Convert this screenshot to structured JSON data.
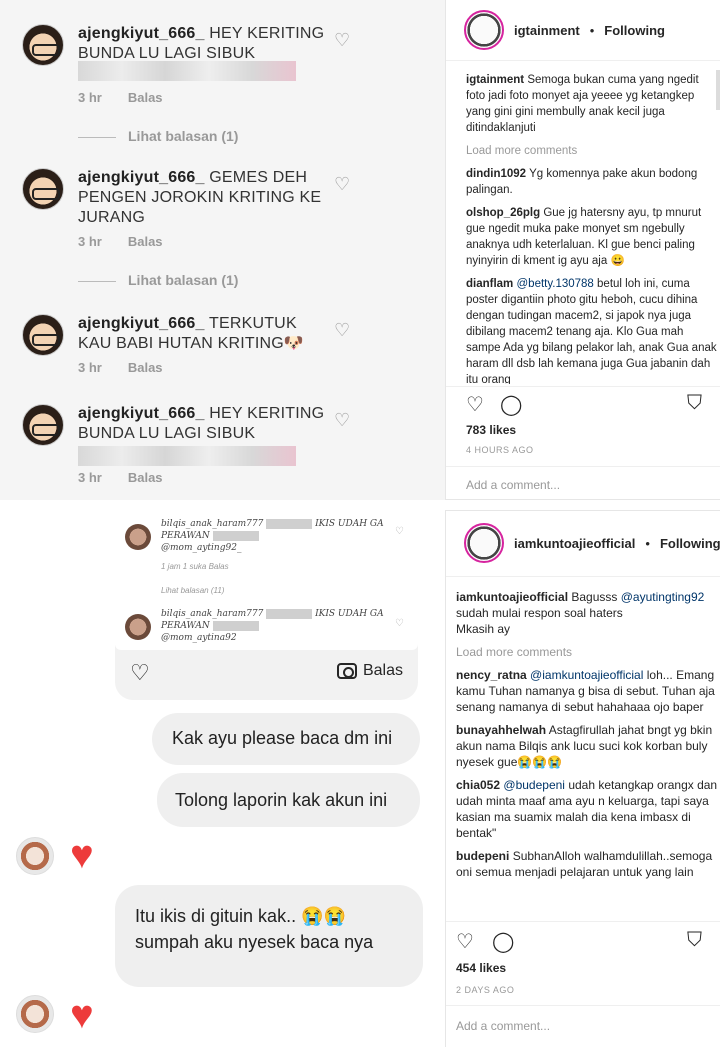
{
  "top_left": {
    "comments": [
      {
        "user": "ajengkiyut_666_",
        "text": "HEY KERITING BUNDA LU LAGI SIBUK",
        "time": "3 hr",
        "reply": "Balas",
        "replies_link": "Lihat balasan (1)"
      },
      {
        "user": "ajengkiyut_666_",
        "text": "GEMES DEH PENGEN JOROKIN KRITING KE JURANG",
        "time": "3 hr",
        "reply": "Balas",
        "replies_link": "Lihat balasan (1)"
      },
      {
        "user": "ajengkiyut_666_",
        "text": "TERKUTUK KAU BABI HUTAN KRITING🐶",
        "time": "3 hr",
        "reply": "Balas"
      },
      {
        "user": "ajengkiyut_666_",
        "text": "HEY KERITING BUNDA LU LAGI SIBUK",
        "time": "3 hr",
        "reply": "Balas"
      }
    ]
  },
  "top_right": {
    "username": "igtainment",
    "follow_status": "Following",
    "caption_user": "igtainment",
    "caption": "Semoga bukan cuma yang ngedit foto jadi foto monyet aja yeeee yg ketangkep yang gini gini membully anak kecil juga ditindaklanjuti",
    "load_more": "Load more comments",
    "comments": [
      {
        "user": "dindin1092",
        "text": "Yg komennya pake akun bodong palingan."
      },
      {
        "user": "olshop_26plg",
        "text": "Gue jg hatersny ayu, tp mnurut gue ngedit muka pake monyet sm ngebully anaknya udh keterlaluan. Kl gue benci paling nyinyirin di kment ig ayu aja 😀"
      },
      {
        "user": "dianflam",
        "mention": "@betty.130788",
        "text": "betul loh ini, cuma poster digantiin photo gitu heboh, cucu dihina dengan tudingan macem2, si japok nya juga dibilang macem2 tenang aja. Klo Gua mah sampe Ada yg bilang pelakor lah, anak Gua anak haram dll dsb lah kemana juga Gua jabanin dah itu orang"
      }
    ],
    "likes": "783 likes",
    "time": "4 HOURS AGO",
    "add_comment": "Add a comment..."
  },
  "bottom_right": {
    "username": "iamkuntoajieofficial",
    "follow_status": "Following",
    "caption_user": "iamkuntoajieofficial",
    "caption_pre": "Bagusss",
    "caption_mention": "@ayutingting92",
    "caption": "sudah mulai respon soal haters",
    "caption_post": "Mkasih ay",
    "load_more": "Load more comments",
    "comments": [
      {
        "user": "nency_ratna",
        "mention": "@iamkuntoajieofficial",
        "text": "loh... Emang kamu Tuhan namanya g bisa di sebut. Tuhan aja senang namanya di sebut hahahaaa ojo baper"
      },
      {
        "user": "bunayahhelwah",
        "text": "Astagfirullah jahat bngt yg bkin akun nama Bilqis ank lucu suci kok korban buly nyesek gue😭😭😭"
      },
      {
        "user": "chia052",
        "mention": "@budepeni",
        "text": "udah ketangkap orangx dan udah minta maaf ama ayu n keluarga, tapi saya kasian ma suamix malah dia kena imbasx di bentak\""
      },
      {
        "user": "budepeni",
        "text": "SubhanAlloh walhamdulillah..semoga oni semua menjadi pelajaran untuk yang lain"
      }
    ],
    "likes": "454 likes",
    "time": "2 DAYS AGO",
    "add_comment": "Add a comment..."
  },
  "bottom_left": {
    "shared": [
      {
        "user": "bilqis_anak_haram777",
        "text": "IKIS UDAH GA PERAWAN",
        "mention": "@mom_ayting92_",
        "meta": "1 jam   1 suka   Balas",
        "replies_link": "Lihat balasan (11)"
      },
      {
        "user": "bilqis_anak_haram777",
        "text": "IKIS UDAH GA PERAWAN",
        "mention": "@mom_aytina92"
      }
    ],
    "reply_label": "Balas",
    "messages": [
      "Kak ayu please baca dm ini",
      "Tolong laporin kak akun ini",
      "Itu ikis di gituin kak.. 😭😭sumpah aku nyesek baca nya"
    ]
  }
}
